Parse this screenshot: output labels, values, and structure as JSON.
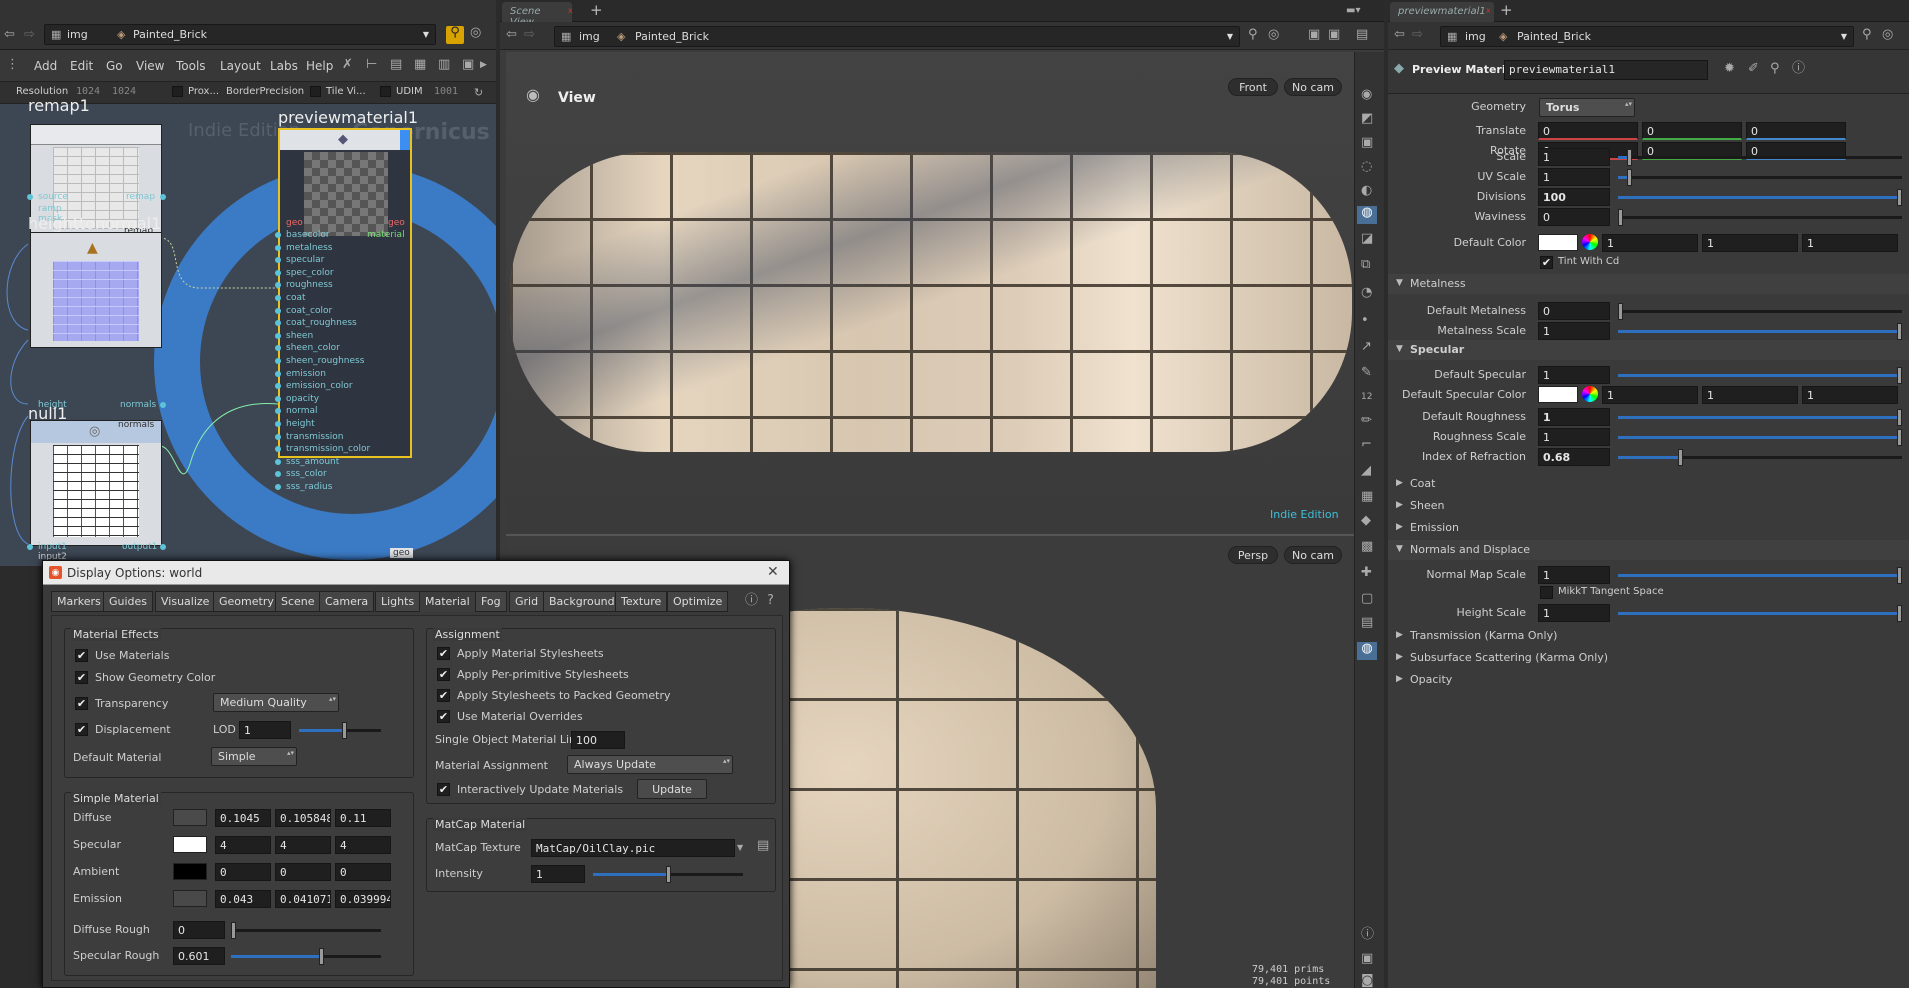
{
  "network": {
    "path": {
      "root": "img",
      "node": "Painted_Brick"
    },
    "menu": [
      "Add",
      "Edit",
      "Go",
      "View",
      "Tools",
      "Layout",
      "Labs",
      "Help"
    ],
    "params": {
      "resolution_label": "Resolution",
      "res_x": "1024",
      "res_y": "1024",
      "proxy": "Prox...",
      "border": "BorderPrecision",
      "tile": "Tile Vi...",
      "udim_label": "UDIM",
      "udim_value": "1001"
    },
    "watermark_edition": "Indie Edition",
    "watermark_context": "Copernicus",
    "nodes": {
      "remap": {
        "name": "remap1",
        "footer": "remap",
        "ports_in": [
          "source",
          "ramp",
          "mask"
        ],
        "port_out": "remap"
      },
      "h2n": {
        "name": "heighttonormal1",
        "footer": "normals",
        "port_in": "height",
        "port_out": "normals"
      },
      "null": {
        "name": "null1",
        "port_in": "input1",
        "port_out": "output1",
        "port_in2": "input2"
      },
      "preview": {
        "name": "previewmaterial1",
        "footer": "geo",
        "in_geo": "geo",
        "out_geo": "geo",
        "out_material": "material",
        "inputs": [
          "basecolor",
          "metalness",
          "specular",
          "spec_color",
          "roughness",
          "coat",
          "coat_color",
          "coat_roughness",
          "sheen",
          "sheen_color",
          "sheen_roughness",
          "emission",
          "emission_color",
          "opacity",
          "normal",
          "height",
          "transmission",
          "transmission_color",
          "sss_amount",
          "sss_color",
          "sss_radius"
        ]
      }
    }
  },
  "scene_view": {
    "tab_label": "Scene View",
    "path": {
      "root": "img",
      "node": "Painted_Brick"
    },
    "top_view": {
      "title": "View",
      "camera_view": "Front",
      "camera": "No cam",
      "edition": "Indie Edition"
    },
    "bottom_view": {
      "camera_view": "Persp",
      "camera": "No cam",
      "prims": "79,401  prims",
      "points": "79,401  points"
    }
  },
  "params_pane": {
    "tab_label": "previewmaterial1",
    "path": {
      "root": "img",
      "node": "Painted_Brick"
    },
    "node_type": "Preview Material",
    "node_name": "previewmaterial1",
    "geometry": {
      "label": "Geometry",
      "value": "Torus"
    },
    "translate": {
      "label": "Translate",
      "values": [
        "0",
        "0",
        "0"
      ]
    },
    "rotate": {
      "label": "Rotate",
      "values": [
        "0",
        "0",
        "0"
      ]
    },
    "scale": {
      "label": "Scale",
      "value": "1",
      "level": 0.04
    },
    "uv_scale": {
      "label": "UV Scale",
      "value": "1",
      "level": 0.04
    },
    "divisions": {
      "label": "Divisions",
      "value": "100",
      "level": 1.0
    },
    "waviness": {
      "label": "Waviness",
      "value": "0",
      "level": 0.0
    },
    "default_color": {
      "label": "Default Color",
      "values": [
        "1",
        "1",
        "1"
      ],
      "swatch": "#ffffff"
    },
    "tint": "Tint With Cd",
    "metalness_section": "Metalness",
    "default_metalness": {
      "label": "Default Metalness",
      "value": "0",
      "level": 0.0
    },
    "metalness_scale": {
      "label": "Metalness Scale",
      "value": "1",
      "level": 1.0
    },
    "specular_section": "Specular",
    "default_specular": {
      "label": "Default Specular",
      "value": "1",
      "level": 1.0
    },
    "default_specular_color": {
      "label": "Default Specular Color",
      "values": [
        "1",
        "1",
        "1"
      ]
    },
    "default_roughness": {
      "label": "Default Roughness",
      "value": "1",
      "level": 1.0
    },
    "roughness_scale": {
      "label": "Roughness Scale",
      "value": "1",
      "level": 1.0
    },
    "ior": {
      "label": "Index of Refraction",
      "value": "0.68",
      "level": 0.22
    },
    "coat_section": "Coat",
    "sheen_section": "Sheen",
    "emission_section": "Emission",
    "normals_section": "Normals and Displace",
    "normal_map_scale": {
      "label": "Normal Map Scale",
      "value": "1",
      "level": 1.0
    },
    "mikkt": "MikkT Tangent Space",
    "height_scale": {
      "label": "Height Scale",
      "value": "1",
      "level": 1.0
    },
    "transmission_section": "Transmission (Karma Only)",
    "sss_section": "Subsurface Scattering (Karma Only)",
    "opacity_section": "Opacity"
  },
  "dialog": {
    "title": "Display Options:  world",
    "tabs": [
      "Markers",
      "Guides",
      "Visualize",
      "Geometry",
      "Scene",
      "Camera",
      "Lights",
      "Material",
      "Fog",
      "Grid",
      "Background",
      "Texture",
      "Optimize"
    ],
    "active_tab": "Material",
    "material_effects": {
      "title": "Material Effects",
      "use_materials": "Use Materials",
      "show_geo_color": "Show Geometry Color",
      "transparency": "Transparency",
      "transparency_quality": "Medium Quality",
      "displacement": "Displacement",
      "lod_label": "LOD",
      "lod_value": "1",
      "lod_level": 0.55,
      "default_material_label": "Default Material",
      "default_material_value": "Simple"
    },
    "simple_material": {
      "title": "Simple Material",
      "rows": [
        {
          "label": "Diffuse",
          "color": "#4a4a4a",
          "values": [
            "0.1045",
            "0.105848",
            "0.11"
          ]
        },
        {
          "label": "Specular",
          "color": "#ffffff",
          "values": [
            "4",
            "4",
            "4"
          ]
        },
        {
          "label": "Ambient",
          "color": "#000000",
          "values": [
            "0",
            "0",
            "0"
          ]
        },
        {
          "label": "Emission",
          "color": "#494949",
          "values": [
            "0.043",
            "0.041071",
            "0.039994"
          ]
        }
      ],
      "diffuse_rough": {
        "label": "Diffuse Rough",
        "value": "0",
        "level": 0.0
      },
      "specular_rough": {
        "label": "Specular Rough",
        "value": "0.601",
        "level": 0.6
      }
    },
    "assignment": {
      "title": "Assignment",
      "apply_material_stylesheets": "Apply Material Stylesheets",
      "apply_per_primitive": "Apply Per-primitive Stylesheets",
      "apply_packed": "Apply Stylesheets to Packed Geometry",
      "use_overrides": "Use Material Overrides",
      "limit_label": "Single Object Material Limit",
      "limit_value": "100",
      "assign_label": "Material Assignment",
      "assign_value": "Always Update",
      "interactive_update": "Interactively Update Materials",
      "update_button": "Update"
    },
    "matcap": {
      "title": "MatCap Material",
      "texture_label": "MatCap Texture",
      "texture_value": "MatCap/OilClay.pic",
      "intensity_label": "Intensity",
      "intensity_value": "1",
      "intensity_level": 0.5
    }
  },
  "colors": {
    "accent": "#2f6fc0",
    "node_selected": "#e8c31f",
    "edition_text": "#3fbfd8",
    "torus": "#c9b79e"
  }
}
